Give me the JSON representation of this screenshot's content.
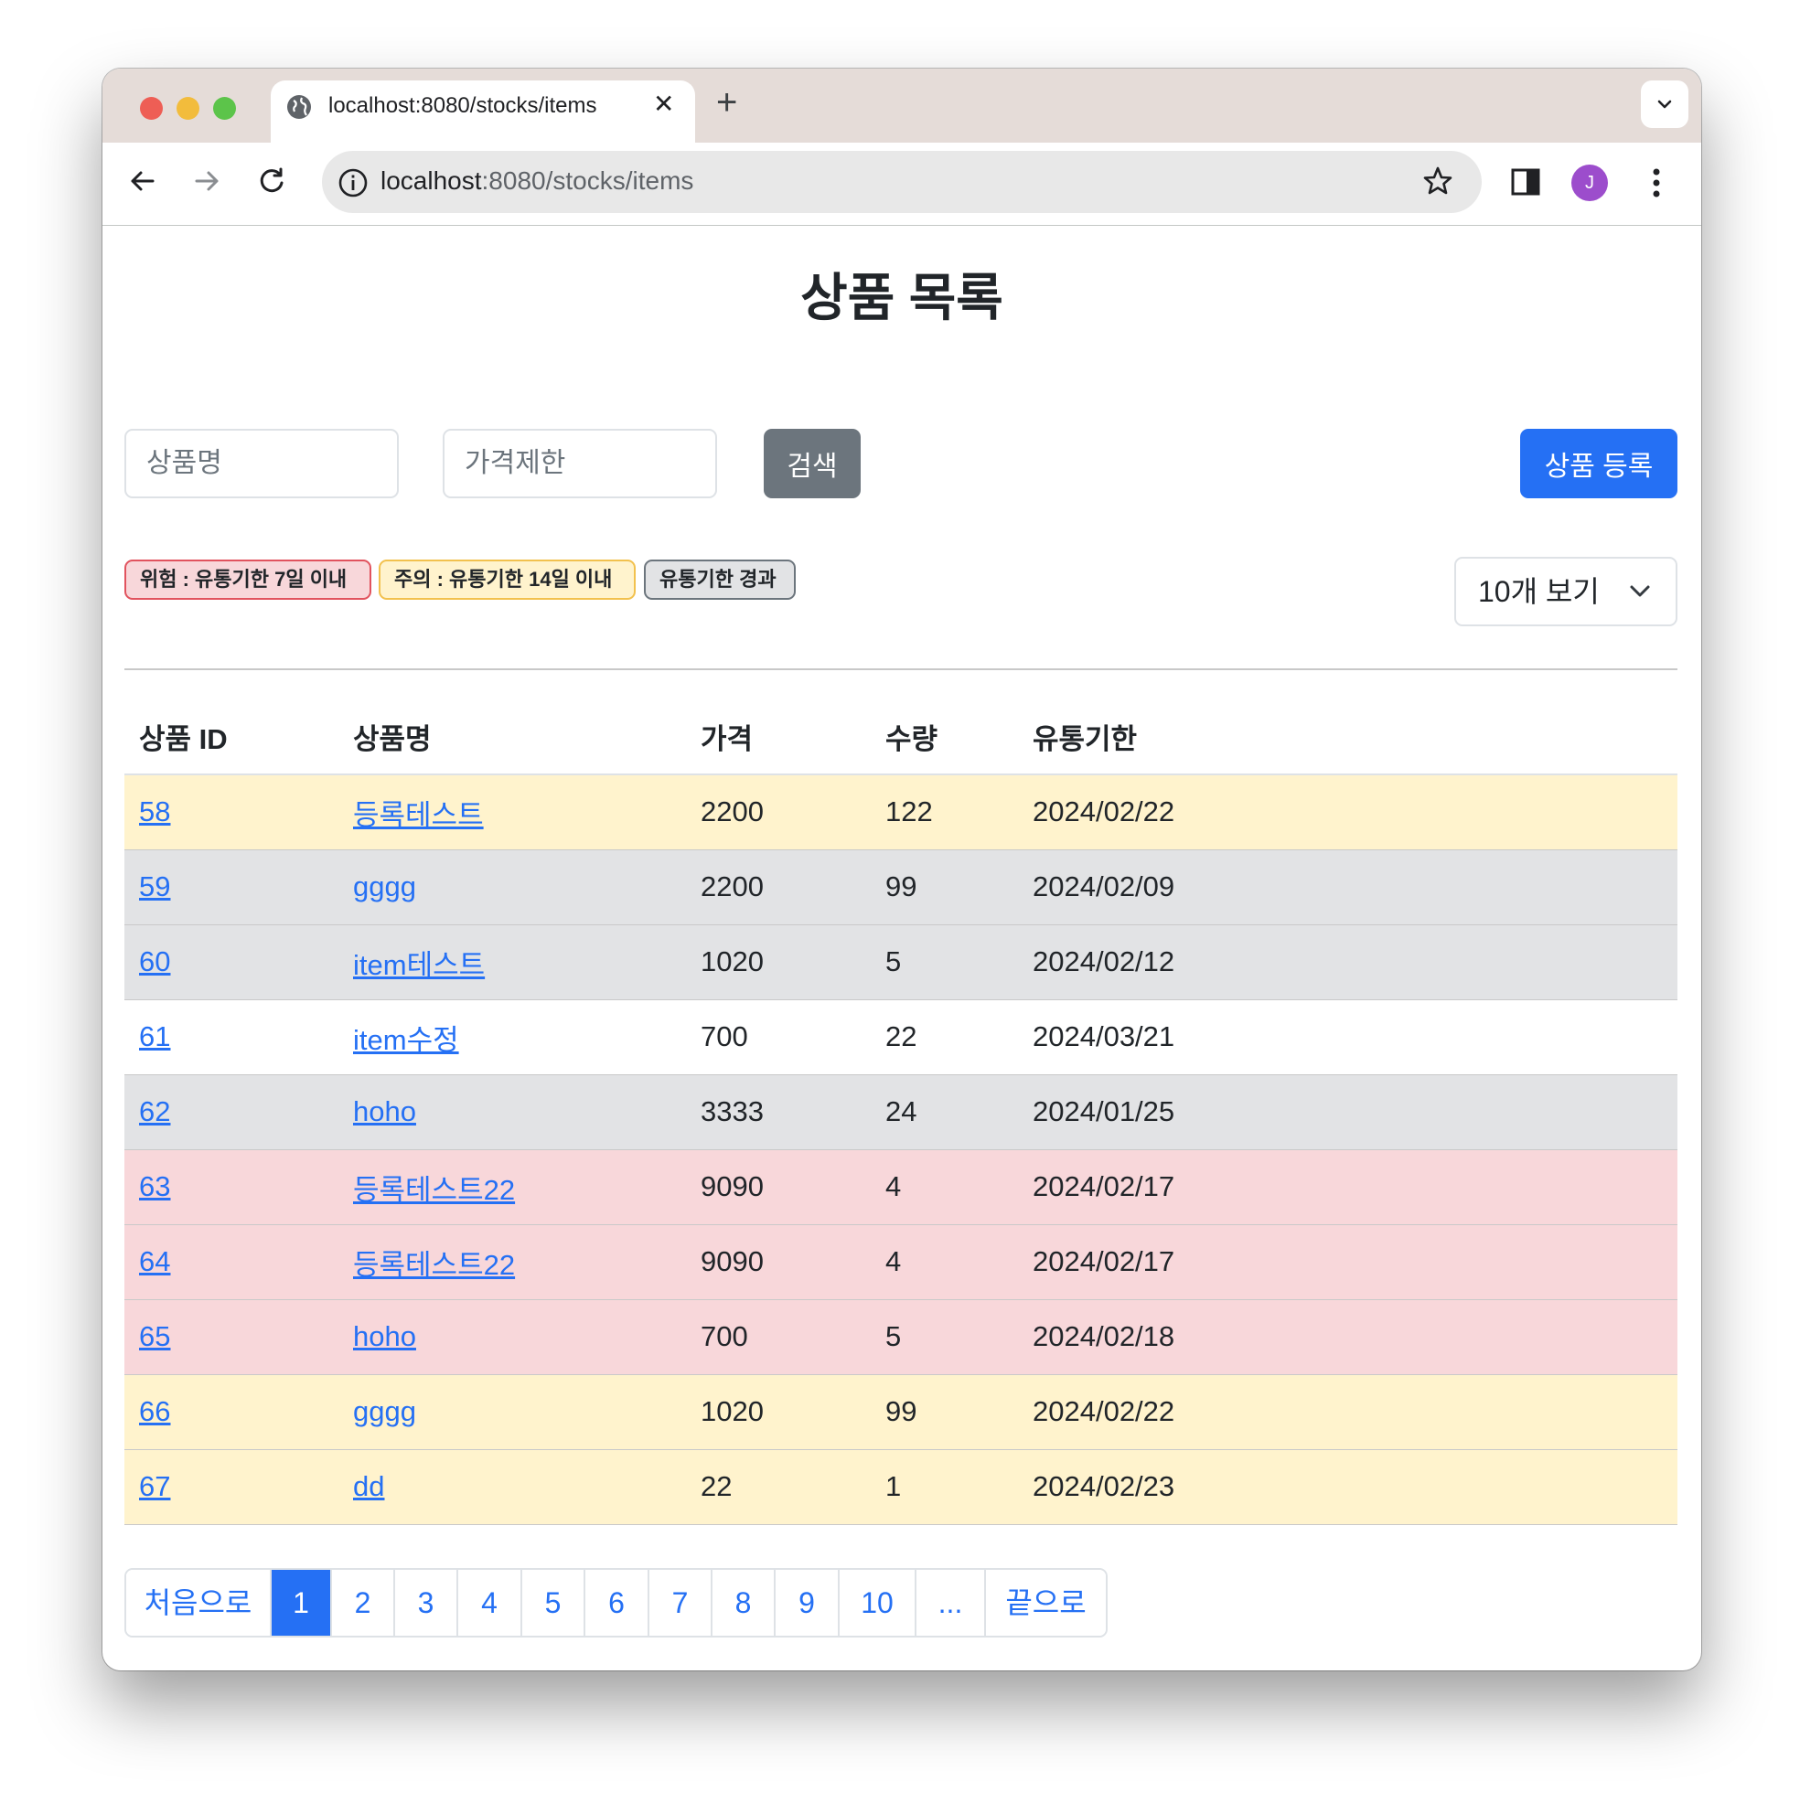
{
  "browser": {
    "tab_title": "localhost:8080/stocks/items",
    "url_host": "localhost",
    "url_path": ":8080/stocks/items",
    "profile_initial": "J"
  },
  "page": {
    "title": "상품 목록",
    "search": {
      "name_placeholder": "상품명",
      "price_placeholder": "가격제한",
      "search_label": "검색"
    },
    "register_label": "상품 등록",
    "legend": {
      "danger": "위험 : 유통기한 7일 이내",
      "warning": "주의 : 유통기한 14일 이내",
      "expired": "유통기한 경과"
    },
    "page_size_selected": "10개 보기",
    "table": {
      "headers": [
        "상품 ID",
        "상품명",
        "가격",
        "수량",
        "유통기한"
      ],
      "rows": [
        {
          "id": "58",
          "name": "등록테스트",
          "price": "2200",
          "qty": "122",
          "expiry": "2024/02/22",
          "status": "warning"
        },
        {
          "id": "59",
          "name": "gggg",
          "price": "2200",
          "qty": "99",
          "expiry": "2024/02/09",
          "status": "expired"
        },
        {
          "id": "60",
          "name": "item테스트",
          "price": "1020",
          "qty": "5",
          "expiry": "2024/02/12",
          "status": "expired"
        },
        {
          "id": "61",
          "name": "item수정",
          "price": "700",
          "qty": "22",
          "expiry": "2024/03/21",
          "status": "normal"
        },
        {
          "id": "62",
          "name": "hoho",
          "price": "3333",
          "qty": "24",
          "expiry": "2024/01/25",
          "status": "expired"
        },
        {
          "id": "63",
          "name": "등록테스트22",
          "price": "9090",
          "qty": "4",
          "expiry": "2024/02/17",
          "status": "danger"
        },
        {
          "id": "64",
          "name": "등록테스트22",
          "price": "9090",
          "qty": "4",
          "expiry": "2024/02/17",
          "status": "danger"
        },
        {
          "id": "65",
          "name": "hoho",
          "price": "700",
          "qty": "5",
          "expiry": "2024/02/18",
          "status": "danger"
        },
        {
          "id": "66",
          "name": "gggg",
          "price": "1020",
          "qty": "99",
          "expiry": "2024/02/22",
          "status": "warning"
        },
        {
          "id": "67",
          "name": "dd",
          "price": "22",
          "qty": "1",
          "expiry": "2024/02/23",
          "status": "warning"
        }
      ]
    },
    "pagination": {
      "first_label": "처음으로",
      "pages": [
        "1",
        "2",
        "3",
        "4",
        "5",
        "6",
        "7",
        "8",
        "9",
        "10"
      ],
      "active_page": "1",
      "ellipsis": "...",
      "last_label": "끝으로"
    },
    "colors": {
      "primary": "#2570f4",
      "secondary": "#6c757d",
      "danger_bg": "#f8d7da",
      "warning_bg": "#fff3cd",
      "expired_bg": "#e2e3e5"
    }
  }
}
